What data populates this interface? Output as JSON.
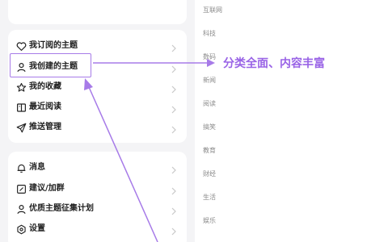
{
  "menu_group_1": [
    {
      "label": "我订阅的主题",
      "icon": "heart-icon"
    },
    {
      "label": "我创建的主题",
      "icon": "user-icon"
    },
    {
      "label": "我的收藏",
      "icon": "star-icon"
    },
    {
      "label": "最近阅读",
      "icon": "book-icon"
    },
    {
      "label": "推送管理",
      "icon": "send-icon"
    }
  ],
  "menu_group_2": [
    {
      "label": "消息",
      "icon": "bell-icon"
    },
    {
      "label": "建议/加群",
      "icon": "edit-icon"
    },
    {
      "label": "优质主题征集计划",
      "icon": "user-icon"
    },
    {
      "label": "设置",
      "icon": "gear-icon"
    }
  ],
  "categories": [
    "互联网",
    "科技",
    "数码",
    "新闻",
    "阅读",
    "搞笑",
    "教育",
    "财经",
    "生活",
    "娱乐"
  ],
  "annotation": {
    "callout_text": "分类全面、内容丰富",
    "accent_color": "#9963e6"
  }
}
